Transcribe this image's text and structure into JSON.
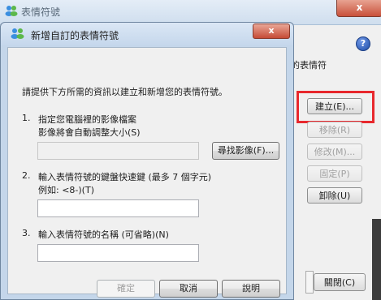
{
  "background_window": {
    "title": "表情符號",
    "close_label": "x",
    "help_label": "?",
    "description_fragment": "E您的表情符",
    "buttons": {
      "create": "建立(E)...",
      "remove": "移除(R)",
      "edit": "修改(M)...",
      "pin": "固定(P)",
      "uninstall": "卸除(U)",
      "close": "關閉(C)"
    }
  },
  "dialog": {
    "title": "新增自訂的表情符號",
    "close_label": "x",
    "intro": "請提供下方所需的資訊以建立和新增您的表情符號。",
    "step1": {
      "number": "1.",
      "label": "指定您電腦裡的影像檔案",
      "sublabel": "影像將會自動調整大小(S)",
      "file_value": "",
      "browse_button": "尋找影像(F)..."
    },
    "step2": {
      "number": "2.",
      "label": "輸入表情符號的鍵盤快速鍵 (最多 7 個字元)",
      "example": "例如: <8-)(T)",
      "value": ""
    },
    "step3": {
      "number": "3.",
      "label": "輸入表情符號的名稱 (可省略)(N)",
      "value": ""
    },
    "buttons": {
      "ok": "確定",
      "cancel": "取消",
      "help": "說明"
    }
  }
}
